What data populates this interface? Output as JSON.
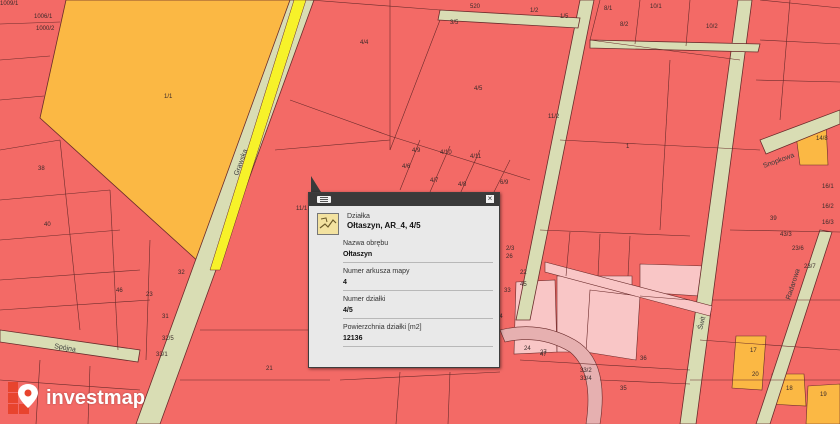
{
  "map": {
    "streets": [
      "Grawska",
      "Spójna",
      "Świt",
      "Radarowa",
      "Snopkowa"
    ],
    "parcel_labels": [
      "1009/1",
      "1006/1",
      "1000/2",
      "520",
      "1/2",
      "1/5",
      "8/1",
      "8/2",
      "10/1",
      "10/2",
      "3/5",
      "1/1",
      "4/4",
      "4/5",
      "4/6",
      "4/7",
      "4/8",
      "4/9",
      "4/10",
      "4/11",
      "6/9",
      "11/1",
      "11/2",
      "1",
      "2/3",
      "21",
      "22",
      "24",
      "27",
      "32",
      "33",
      "34",
      "44",
      "45",
      "46",
      "47",
      "23",
      "31",
      "32/5",
      "33/1",
      "33/2",
      "33/4",
      "35",
      "36",
      "38",
      "40",
      "39",
      "43/3",
      "23/6",
      "23/7",
      "14/8",
      "16/1",
      "16/2",
      "16/3",
      "17",
      "18",
      "19",
      "20",
      "26"
    ],
    "colors": {
      "parcel": "#f36a66",
      "orange": "#fbb844",
      "pink": "#f9c6c6",
      "road": "#d9ddb4",
      "outline": "#6a2b2b",
      "highlight": "#f7f229"
    }
  },
  "popup": {
    "type_label": "Działka",
    "title": "Ołtaszyn, AR_4, 4/5",
    "fields": [
      {
        "label": "Nazwa obrębu",
        "value": "Ołtaszyn"
      },
      {
        "label": "Numer arkusza mapy",
        "value": "4"
      },
      {
        "label": "Numer działki",
        "value": "4/5"
      },
      {
        "label": "Powierzchnia działki [m2]",
        "value": "12136"
      }
    ],
    "icons": {
      "menu": "list-icon",
      "close": "close-icon",
      "parcel": "parcel-map-icon"
    }
  },
  "brand": {
    "name": "investmap"
  }
}
